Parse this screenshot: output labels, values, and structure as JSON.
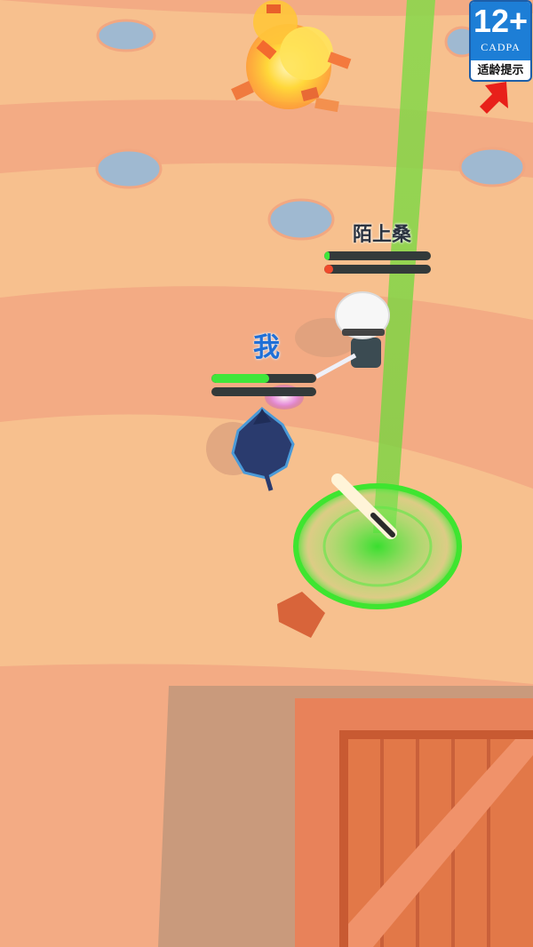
{
  "rating_badge": {
    "age": "12+",
    "org": "CADPA",
    "label": "适龄提示"
  },
  "enemy": {
    "name": "陌上桑",
    "health": 0.05,
    "energy": 0.08
  },
  "player": {
    "name": "我",
    "health": 0.55,
    "energy": 0.0
  },
  "colors": {
    "ground": "#f7c08e",
    "ground_stripe": "#f2a781",
    "beam": "#8fd64a",
    "ring": "#39e52b",
    "health_fill": "#3fe63a",
    "energy_fill": "#f04a2c",
    "crate": "#e87f4e",
    "pad": "#9fb9d1"
  },
  "icons": [
    "explosion-icon",
    "offscreen-arrow-icon",
    "baseball-bat-icon"
  ]
}
